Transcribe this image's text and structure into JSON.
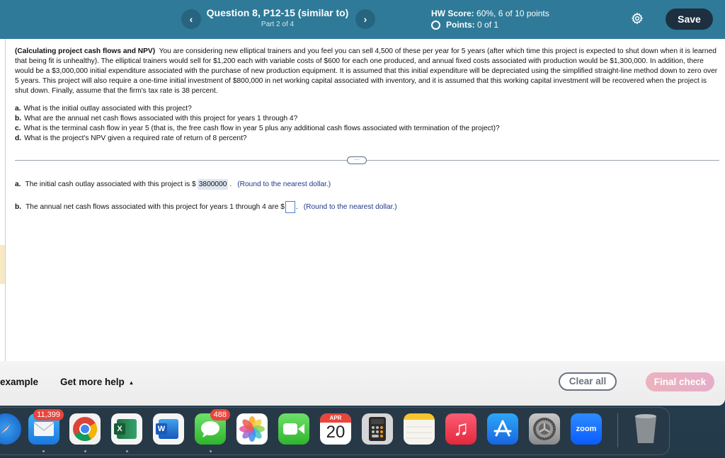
{
  "header": {
    "question_title": "Question 8, P12-15 (similar to)",
    "part": "Part 2 of 4",
    "prev_label": "‹",
    "next_label": "›",
    "hw_score_label": "HW Score:",
    "hw_score_value": "60%, 6 of 10 points",
    "points_label": "Points:",
    "points_value": "0 of 1",
    "settings_icon": "gear-icon",
    "save_label": "Save"
  },
  "problem": {
    "heading": "(Calculating project cash flows and NPV)",
    "text": "You are considering new elliptical trainers and you feel you can sell 4,500 of these per year for 5 years (after which time this project is expected to shut down when it is learned that being fit is unhealthy).  The elliptical trainers would sell for $1,200 each with variable costs of $600 for each one produced, and annual fixed costs associated with production would be $1,300,000.  In addition, there would be a $3,000,000 initial expenditure associated with the purchase of new production equipment.  It is assumed that this initial expenditure will be depreciated using the simplified straight-line method down to zero over 5 years.  This project will also require a one-time initial investment of $800,000 in net working capital associated with inventory, and it is assumed that this working capital investment will be recovered when the project is shut down.  Finally, assume that the firm's tax rate is 38 percent."
  },
  "questions": [
    {
      "letter": "a.",
      "text": "What is the initial outlay associated with this project?"
    },
    {
      "letter": "b.",
      "text": "What are the annual net cash flows associated with this project for years 1 through 4?"
    },
    {
      "letter": "c.",
      "text": "What is the terminal cash flow in year 5 (that is, the free cash flow in year 5 plus any additional cash flows associated with termination of the project)?"
    },
    {
      "letter": "d.",
      "text": "What is the project's NPV given a required rate of return of 8 percent?"
    }
  ],
  "divider": {
    "more_label": "···"
  },
  "answers": {
    "a": {
      "letter": "a.",
      "text": "The initial cash outlay associated with this project is $",
      "value": "3800000",
      "suffix": ".",
      "hint": "(Round to the nearest dollar.)"
    },
    "b": {
      "letter": "b.",
      "text": "The annual net cash flows associated with this project for years 1 through 4 are $",
      "value": "",
      "suffix": ".",
      "hint": "(Round to the nearest dollar.)"
    }
  },
  "footer": {
    "example_label": "example",
    "help_label": "Get more help",
    "help_caret": "▴",
    "clear_label": "Clear all",
    "final_label": "Final check"
  },
  "dock": {
    "apps": [
      {
        "name": "Safari",
        "icon": "safari-icon"
      },
      {
        "name": "Mail",
        "icon": "mail-icon",
        "badge": "11,399"
      },
      {
        "name": "Chrome",
        "icon": "chrome-icon"
      },
      {
        "name": "Excel",
        "icon": "excel-icon",
        "glyph": "X"
      },
      {
        "name": "Word",
        "icon": "word-icon",
        "glyph": "W"
      },
      {
        "name": "Messages",
        "icon": "messages-icon",
        "badge": "488"
      },
      {
        "name": "Photos",
        "icon": "photos-icon"
      },
      {
        "name": "FaceTime",
        "icon": "facetime-icon"
      },
      {
        "name": "Calendar",
        "icon": "calendar-icon",
        "month": "APR",
        "day": "20"
      },
      {
        "name": "Calculator",
        "icon": "calculator-icon"
      },
      {
        "name": "Notes",
        "icon": "notes-icon"
      },
      {
        "name": "Music",
        "icon": "music-icon",
        "glyph": "♫"
      },
      {
        "name": "App Store",
        "icon": "app-store-icon",
        "glyph": "A"
      },
      {
        "name": "System Preferences",
        "icon": "system-preferences-icon"
      },
      {
        "name": "Zoom",
        "icon": "zoom-icon",
        "glyph": "zoom"
      },
      {
        "name": "Trash",
        "icon": "trash-icon"
      }
    ]
  },
  "colors": {
    "header_bg": "#2f7a98",
    "save_bg": "#1e3040",
    "hint_text": "#1e3a8a",
    "final_check_bg": "#ecb2bd",
    "answer_highlight": "#dfe7f1"
  }
}
